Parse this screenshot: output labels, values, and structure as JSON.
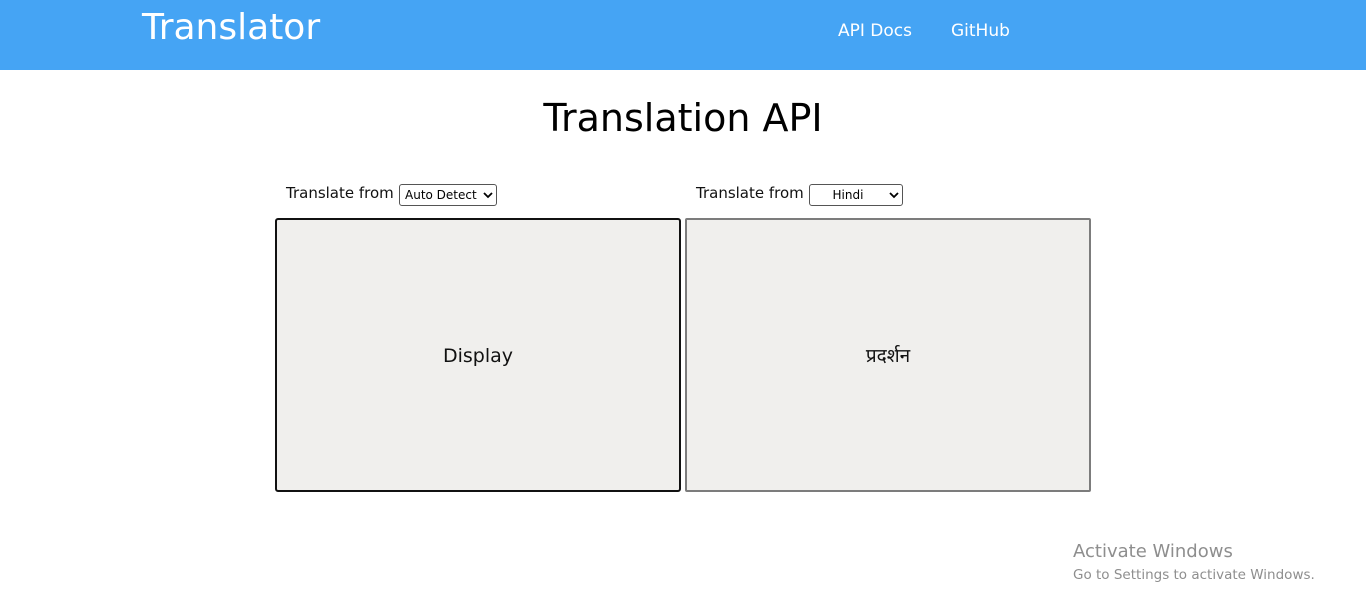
{
  "navbar": {
    "brand": "Translator",
    "links": [
      "API Docs",
      "GitHub"
    ],
    "background": "#45a4f4"
  },
  "main": {
    "title": "Translation API",
    "source": {
      "label": "Translate from",
      "selected_language": "Auto Detect",
      "text": "Display"
    },
    "target": {
      "label": "Translate from",
      "selected_language": "Hindi",
      "text": "प्रदर्शन"
    }
  },
  "watermark": {
    "title": "Activate Windows",
    "subtitle": "Go to Settings to activate Windows."
  }
}
